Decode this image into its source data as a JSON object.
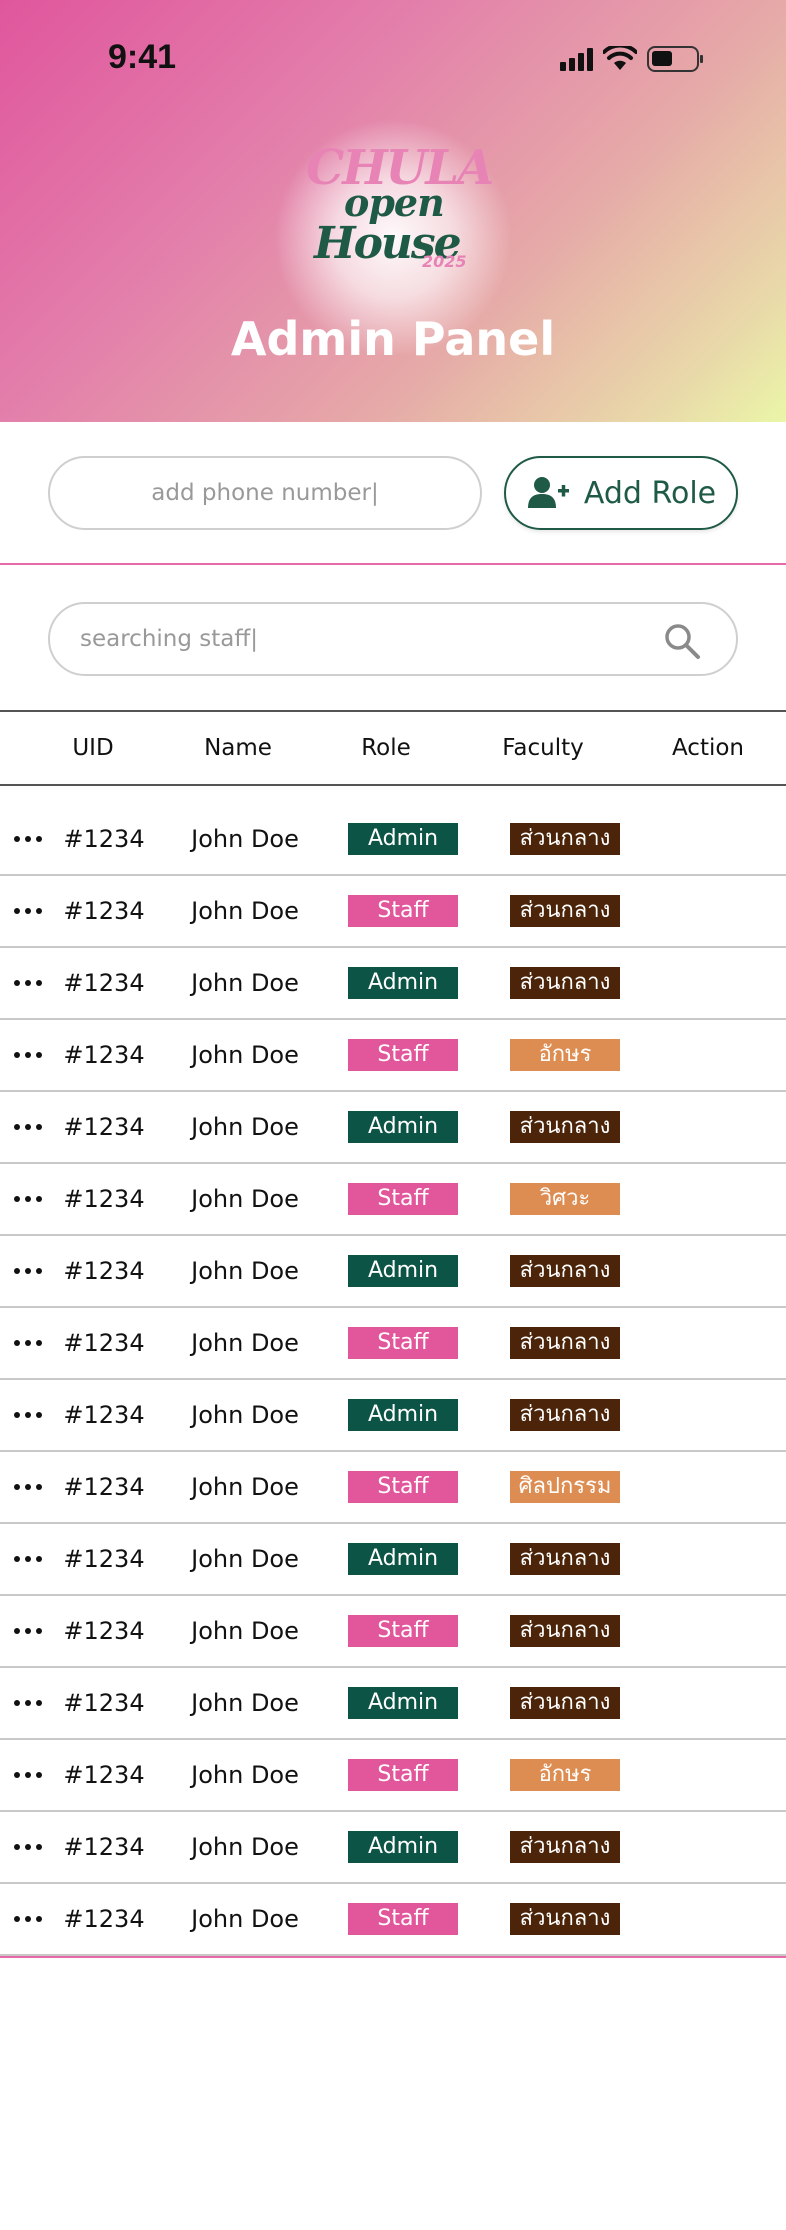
{
  "status_bar": {
    "time": "9:41"
  },
  "header": {
    "logo_lines": [
      "CHULA",
      "open",
      "House",
      "2025"
    ],
    "title": "Admin Panel"
  },
  "add_role": {
    "phone_placeholder": "add phone number|",
    "button_label": "Add Role"
  },
  "search": {
    "placeholder": "searching staff|"
  },
  "table": {
    "columns": [
      "UID",
      "Name",
      "Role",
      "Faculty",
      "Action"
    ],
    "rows": [
      {
        "uid": "#1234",
        "name": "John Doe",
        "role": "Admin",
        "faculty": "ส่วนกลาง"
      },
      {
        "uid": "#1234",
        "name": "John Doe",
        "role": "Staff",
        "faculty": "ส่วนกลาง"
      },
      {
        "uid": "#1234",
        "name": "John Doe",
        "role": "Admin",
        "faculty": "ส่วนกลาง"
      },
      {
        "uid": "#1234",
        "name": "John Doe",
        "role": "Staff",
        "faculty": "อักษร"
      },
      {
        "uid": "#1234",
        "name": "John Doe",
        "role": "Admin",
        "faculty": "ส่วนกลาง"
      },
      {
        "uid": "#1234",
        "name": "John Doe",
        "role": "Staff",
        "faculty": "วิศวะ"
      },
      {
        "uid": "#1234",
        "name": "John Doe",
        "role": "Admin",
        "faculty": "ส่วนกลาง"
      },
      {
        "uid": "#1234",
        "name": "John Doe",
        "role": "Staff",
        "faculty": "ส่วนกลาง"
      },
      {
        "uid": "#1234",
        "name": "John Doe",
        "role": "Admin",
        "faculty": "ส่วนกลาง"
      },
      {
        "uid": "#1234",
        "name": "John Doe",
        "role": "Staff",
        "faculty": "ศิลปกรรม"
      },
      {
        "uid": "#1234",
        "name": "John Doe",
        "role": "Admin",
        "faculty": "ส่วนกลาง"
      },
      {
        "uid": "#1234",
        "name": "John Doe",
        "role": "Staff",
        "faculty": "ส่วนกลาง"
      },
      {
        "uid": "#1234",
        "name": "John Doe",
        "role": "Admin",
        "faculty": "ส่วนกลาง"
      },
      {
        "uid": "#1234",
        "name": "John Doe",
        "role": "Staff",
        "faculty": "อักษร"
      },
      {
        "uid": "#1234",
        "name": "John Doe",
        "role": "Admin",
        "faculty": "ส่วนกลาง"
      },
      {
        "uid": "#1234",
        "name": "John Doe",
        "role": "Staff",
        "faculty": "ส่วนกลาง"
      }
    ]
  },
  "colors": {
    "role_admin": "#0c5445",
    "role_staff": "#e2569c",
    "faculty_central": "#4b2409",
    "faculty_other": "#de8d52",
    "accent_pink": "#e66aa5",
    "accent_green": "#1f5a47"
  },
  "icons": {
    "add_user": "add-user-icon",
    "search": "search-icon",
    "action": "more-horizontal-icon"
  }
}
